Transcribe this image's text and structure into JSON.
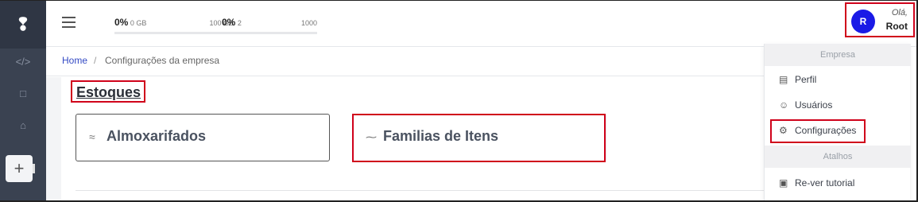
{
  "sidebar": {
    "logo": "❢",
    "items": [
      {
        "icon": "code-icon",
        "glyph": "</>"
      },
      {
        "icon": "document-icon",
        "glyph": "□"
      },
      {
        "icon": "bell-icon",
        "glyph": "⌂"
      }
    ],
    "add_label": "+"
  },
  "topbar": {
    "storage": {
      "pct": "0%",
      "current": "0 GB",
      "max": "100 GB",
      "fill": 0
    },
    "count": {
      "pct": "0%",
      "current": "2",
      "max": "1000",
      "fill": 0
    },
    "user": {
      "initial": "R",
      "greeting": "Olá,",
      "name": "Root"
    }
  },
  "breadcrumb": {
    "home": "Home",
    "separator": "/",
    "current": "Configurações da empresa"
  },
  "section": {
    "title": "Estoques"
  },
  "cards": [
    {
      "label": "Almoxarifados",
      "icon": "layers-icon",
      "glyph": "≈"
    },
    {
      "label": "Familias de Itens",
      "icon": "tag-icon",
      "glyph": "⁓"
    }
  ],
  "menu": {
    "company_header": "Empresa",
    "company_items": [
      {
        "label": "Perfil",
        "icon": "profile-icon",
        "glyph": "▤"
      },
      {
        "label": "Usuários",
        "icon": "user-icon",
        "glyph": "☺"
      },
      {
        "label": "Configurações",
        "icon": "settings-icon",
        "glyph": "⚙"
      }
    ],
    "shortcuts_header": "Atalhos",
    "shortcut_items": [
      {
        "label": "Re-ver tutorial",
        "icon": "book-icon",
        "glyph": "▣"
      }
    ]
  },
  "colors": {
    "highlight": "#d0021b",
    "accent": "#1a1ae6",
    "sidebar": "#3a4251"
  }
}
